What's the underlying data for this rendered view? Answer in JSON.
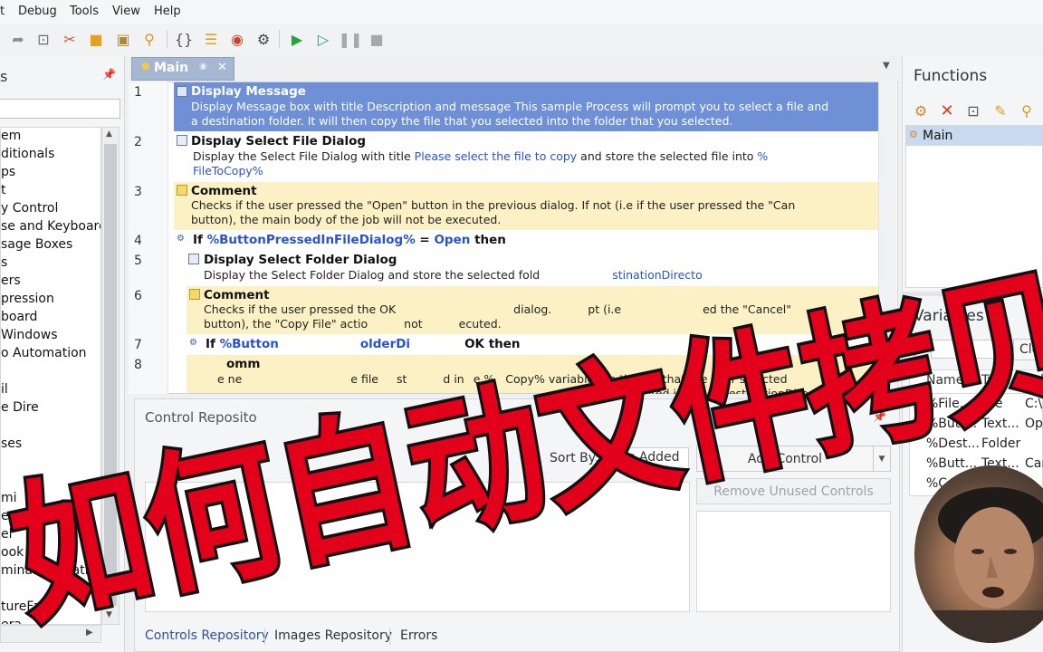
{
  "menu": [
    "t",
    "Debug",
    "Tools",
    "View",
    "Help"
  ],
  "toolbar_icons": [
    "redo-icon",
    "step-icon",
    "cut-icon",
    "copy-icon",
    "paste-icon",
    "find-icon",
    "braces-icon",
    "notes-icon",
    "record-icon",
    "web-recorder-icon",
    "run-icon",
    "step-run-icon",
    "pause-icon",
    "stop-icon"
  ],
  "left_panel": {
    "title": "s",
    "items": [
      "em",
      "ditionals",
      "ps",
      "t",
      "y Control",
      "se and Keyboard",
      "sage Boxes",
      "s",
      "ers",
      "pression",
      "board",
      "Windows",
      "o Automation",
      "",
      "il",
      "e Dire",
      "",
      "ses",
      "",
      "mi",
      "e",
      "el",
      "ook",
      "minal Emulation",
      "",
      "tureFast",
      "era"
    ]
  },
  "tab": {
    "label": "Main"
  },
  "editor": {
    "lines": [
      {
        "num": "1",
        "title": "Display Message",
        "text1": "Display Message box with title Description and message This sample Process will prompt you to select a file and",
        "text2": "a destination folder. It will then copy the file that you selected into the folder that you selected."
      },
      {
        "num": "2",
        "title": "Display Select File Dialog",
        "text1_a": "Display the Select File Dialog with title ",
        "text1_b": "Please select the file to copy",
        "text1_c": " and store the selected file into ",
        "text1_d": "%",
        "text2": "FileToCopy%"
      },
      {
        "num": "3",
        "title": "Comment",
        "text1": "Checks if the user pressed the \"Open\" button in the previous dialog. If not (i.e if the user pressed the \"Can",
        "text2": "button), the main body of the job will not be executed."
      },
      {
        "num": "4",
        "if_kw": "If ",
        "if_var": "%ButtonPressedInFileDialog%",
        "if_eq": " = ",
        "if_val": "Open",
        "if_then": " then"
      },
      {
        "num": "5",
        "title": "Display Select Folder Dialog",
        "text1_a": "Display the Select Folder Dialog and store the selected fold",
        "text1_b": "stinationDirecto"
      },
      {
        "num": "6",
        "title": "Comment",
        "text1": "Checks if the user pressed the OK",
        "text1_b": "dialog.",
        "text1_c": "pt (i.e",
        "text1_d": "ed the \"Cancel\"",
        "text2": "button), the \"Copy File\" actio",
        "text2_b": "not",
        "text2_c": "ecuted."
      },
      {
        "num": "7",
        "if_kw": "If ",
        "if_var": "%Button",
        "if_rest": "olderDi",
        "if_then": "OK then"
      },
      {
        "num": "8",
        "title": "omm",
        "text1": "e ne",
        "text1_b": "e file",
        "text1_c": "st",
        "text1_d": "d in",
        "text1_e": "e %",
        "text1_f": "Copy% variable (i.e the file that the user selected",
        "text2": "stored in the %DestinationDirectory% (i.e the"
      }
    ]
  },
  "control_repository": {
    "title": "Control Reposito",
    "sort_label": "Sort By:",
    "sort_value": "Date Added",
    "add_button": "Add Control",
    "remove_button": "Remove Unused Controls",
    "bottom_tabs": [
      "Controls Repository",
      "Images Repository",
      "Errors"
    ]
  },
  "functions": {
    "title": "Functions",
    "items": [
      "Main"
    ]
  },
  "variables": {
    "title": "Variables",
    "clear_button": "Clea",
    "columns": [
      "Name",
      "Type",
      "Val"
    ],
    "rows": [
      [
        "%File...",
        "File",
        "C:\\"
      ],
      [
        "%Butt...",
        "Text...",
        "Ope"
      ],
      [
        "%Dest...",
        "Folder",
        ""
      ],
      [
        "%Butt...",
        "Text...",
        "Can"
      ],
      [
        "%C",
        "",
        ""
      ]
    ]
  },
  "overlay": {
    "caption": "如何自动文件拷贝"
  },
  "colors": {
    "selected_block": "#6f8fd6",
    "comment_bg": "#fbf1c4",
    "overlay_red": "#e3001b",
    "link_blue": "#2952cc"
  }
}
